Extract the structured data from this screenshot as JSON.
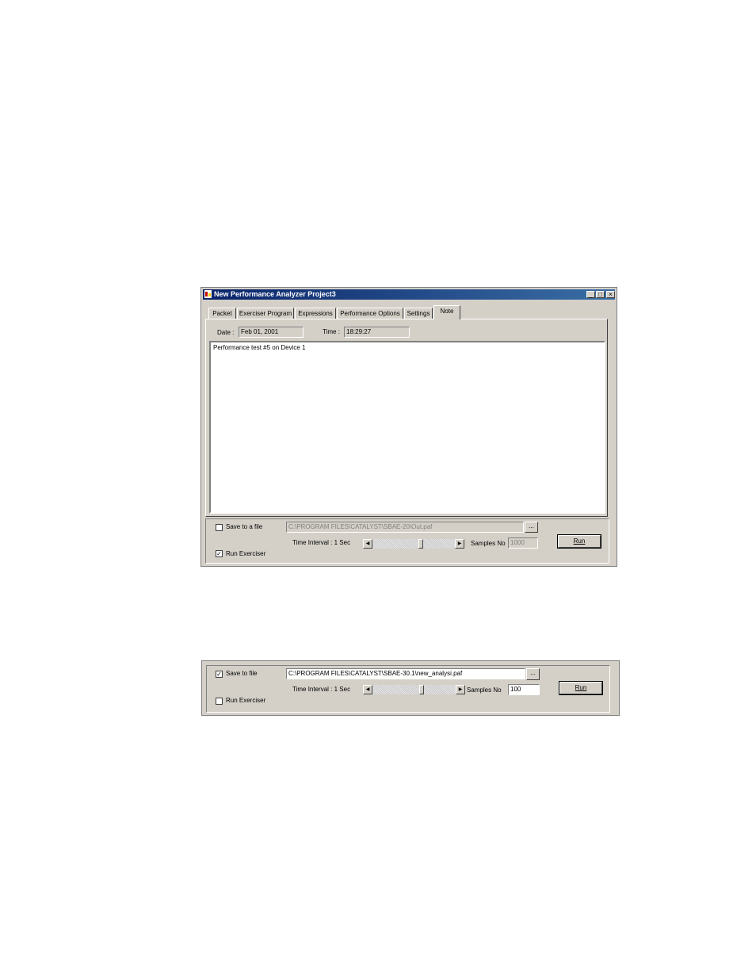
{
  "window": {
    "title": "New Performance Analyzer Project3",
    "caption_buttons": {
      "minimize": "_",
      "maximize": "□",
      "close": "×"
    },
    "tabs": [
      {
        "label": "Packet",
        "active": false
      },
      {
        "label": "Exerciser Program",
        "active": false
      },
      {
        "label": "Expressions",
        "active": false
      },
      {
        "label": "Performance Options",
        "active": false
      },
      {
        "label": "Settings",
        "active": false
      },
      {
        "label": "Note",
        "active": true
      }
    ],
    "note_tab": {
      "date_label": "Date :",
      "date_value": "Feb 01, 2001",
      "time_label": "Time :",
      "time_value": "18:29:27",
      "note_text": "Performance test #5 on Device 1"
    },
    "bottom": {
      "save_to_file_label": "Save to a file",
      "save_to_file_checked": false,
      "file_path": "C:\\PROGRAM FILES\\CATALYST\\SBAE-20\\Out.paf",
      "browse_label": "...",
      "time_interval_label": "Time Interval : 1 Sec",
      "samples_label": "Samples No",
      "samples_value": "1000",
      "run_label": "Run",
      "run_exerciser_label": "Run Exerciser",
      "run_exerciser_checked": true,
      "check_mark": "✓",
      "slider_left_arrow": "◀",
      "slider_right_arrow": "▶"
    }
  },
  "panel2": {
    "save_to_file_label": "Save to file",
    "save_to_file_checked": true,
    "file_path": "C:\\PROGRAM FILES\\CATALYST\\SBAE-30.1\\new_analysi.paf",
    "browse_label": "...",
    "time_interval_label": "Time Interval : 1 Sec",
    "samples_label": "Samples No",
    "samples_value": "100",
    "run_label": "Run",
    "run_exerciser_label": "Run Exerciser",
    "run_exerciser_checked": false,
    "check_mark": "✓",
    "slider_left_arrow": "◀",
    "slider_right_arrow": "▶"
  }
}
